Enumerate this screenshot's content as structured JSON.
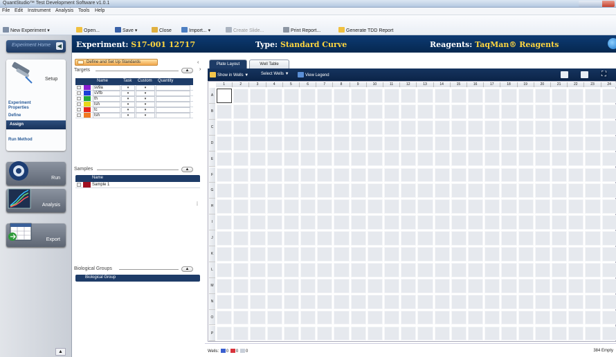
{
  "window": {
    "title": "QuantStudio™ Test Development Software v1.0.1"
  },
  "menu": [
    "File",
    "Edit",
    "Instrument",
    "Analysis",
    "Tools",
    "Help"
  ],
  "toolbar": {
    "new_experiment": "New Experiment",
    "open": "Open...",
    "save": "Save",
    "close": "Close",
    "import": "Import...",
    "create_slide": "Create Slide...",
    "print_report": "Print Report...",
    "generate_tdd": "Generate TDD Report"
  },
  "sidebar": {
    "home": "Experiment Home",
    "setup_title": "Setup",
    "setup_items": [
      "Experiment Properties",
      "Define",
      "Assign",
      "Run Method"
    ],
    "run": "Run",
    "analysis": "Analysis",
    "export": "Export"
  },
  "header": {
    "experiment_label": "Experiment:",
    "experiment_value": "S17-001 12717",
    "type_label": "Type:",
    "type_value": "Standard Curve",
    "reagents_label": "Reagents:",
    "reagents_value": "TaqMan® Reagents"
  },
  "define_standards_button": "Define and Set Up Standards",
  "targets": {
    "section": "Targets",
    "columns": [
      "Name",
      "Task",
      "Custom",
      "Quantity"
    ],
    "rows": [
      {
        "name": "sv9a",
        "color": "#8a1fd0"
      },
      {
        "name": "sVfb",
        "color": "#1a3fd8"
      },
      {
        "name": "th",
        "color": "#22a83a"
      },
      {
        "name": "tsh",
        "color": "#e8d81a"
      },
      {
        "name": "tc",
        "color": "#e8231a"
      },
      {
        "name": "tsh",
        "color": "#f07a22"
      }
    ]
  },
  "samples": {
    "section": "Samples",
    "columns": [
      "Name"
    ],
    "rows": [
      {
        "name": "Sample 1",
        "color": "#a01020"
      }
    ]
  },
  "bio_groups": {
    "section": "Biological Groups",
    "header": "Biological Group"
  },
  "plate": {
    "tabs": [
      "Plate Layout",
      "Well Table"
    ],
    "controls": {
      "show_in_wells": "Show in Wells",
      "select_wells": "Select Wells",
      "view_legend": "View Legend"
    },
    "columns": [
      "1",
      "2",
      "3",
      "4",
      "5",
      "6",
      "7",
      "8",
      "9",
      "10",
      "11",
      "12",
      "13",
      "14",
      "15",
      "16",
      "17",
      "18",
      "19",
      "20",
      "21",
      "22",
      "23",
      "24"
    ],
    "rows": [
      "A",
      "B",
      "C",
      "D",
      "E",
      "F",
      "G",
      "H",
      "I",
      "J",
      "K",
      "L",
      "M",
      "N",
      "O",
      "P"
    ]
  },
  "status": {
    "wells_label": "Wells:",
    "count_a": "0",
    "count_b": "0",
    "count_c": "0",
    "empty": "384 Empty"
  }
}
